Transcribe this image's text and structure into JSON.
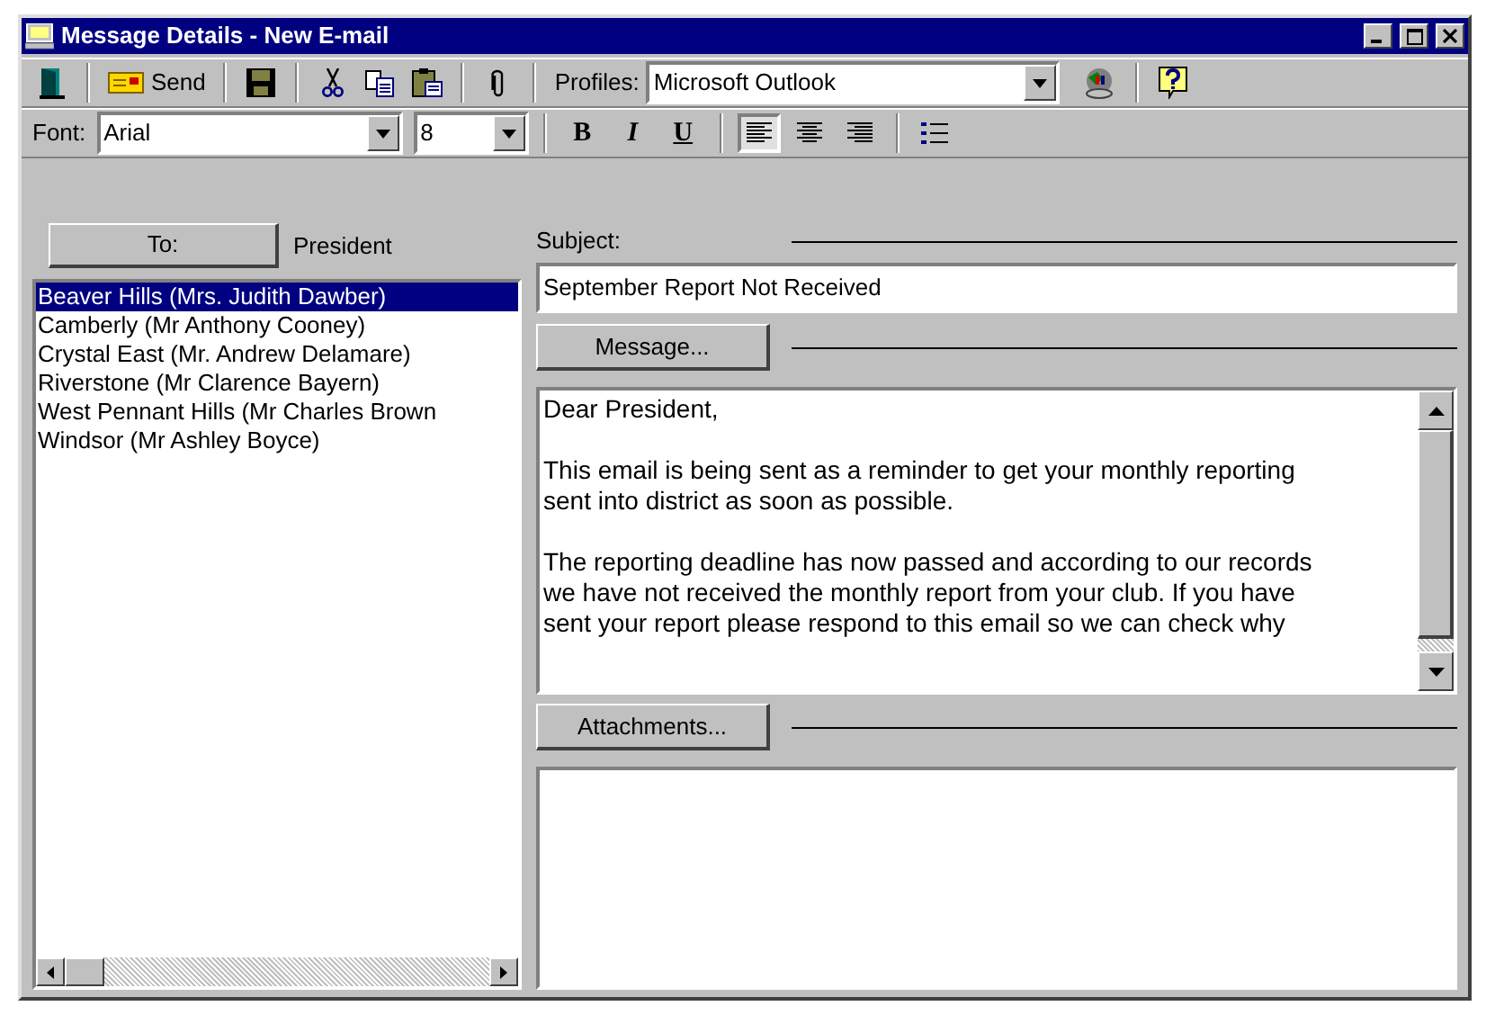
{
  "window": {
    "title": "Message Details - New E-mail"
  },
  "toolbar": {
    "send_label": "Send",
    "profiles_label": "Profiles:",
    "profile_value": "Microsoft Outlook"
  },
  "format_bar": {
    "font_label": "Font:",
    "font_value": "Arial",
    "size_value": "8",
    "style_buttons": [
      {
        "label": "B",
        "kind": "bold"
      },
      {
        "label": "I",
        "kind": "italic"
      },
      {
        "label": "U",
        "kind": "underline"
      }
    ],
    "align_buttons": [
      {
        "kind": "left",
        "selected": true
      },
      {
        "kind": "center",
        "selected": false
      },
      {
        "kind": "right",
        "selected": false
      }
    ]
  },
  "recipients": {
    "to_button": "To:",
    "to_value": "President",
    "items": [
      {
        "label": "Beaver Hills (Mrs. Judith Dawber)",
        "selected": true
      },
      {
        "label": "Camberly (Mr Anthony Cooney)",
        "selected": false
      },
      {
        "label": "Crystal East (Mr. Andrew Delamare)",
        "selected": false
      },
      {
        "label": "Riverstone (Mr Clarence Bayern)",
        "selected": false
      },
      {
        "label": "West Pennant Hills (Mr Charles Brown",
        "selected": false
      },
      {
        "label": "Windsor (Mr Ashley Boyce)",
        "selected": false
      }
    ]
  },
  "subject": {
    "label": "Subject:",
    "value": "September Report Not Received"
  },
  "message": {
    "button": "Message...",
    "paragraphs": [
      "Dear President,",
      "This email is being sent as a reminder to get your monthly reporting sent into district as soon as possible.",
      "The reporting deadline has now passed and according to our records we have not received the monthly report from your club. If you have sent your report please respond to this email so we can check why"
    ]
  },
  "attachments": {
    "button": "Attachments..."
  }
}
